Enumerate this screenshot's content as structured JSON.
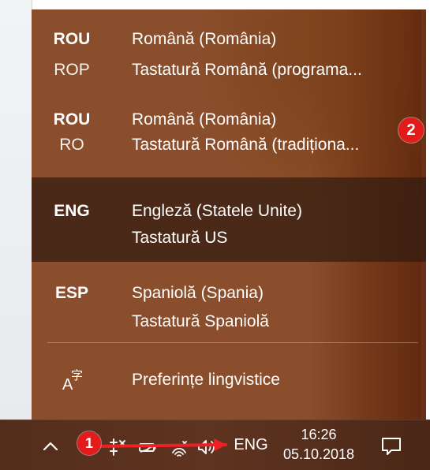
{
  "theme": {
    "flyout_background": "#8b4e2c",
    "selected_row_background": "#3b2218",
    "taskbar_background": "#5a311e",
    "text_color": "#ffffff",
    "badge_color": "#e41b1b"
  },
  "language_flyout": {
    "items": [
      {
        "code_primary": "ROU",
        "code_secondary": "ROP",
        "language": "Română (România)",
        "keyboard": "Tastatură Română (programa..."
      },
      {
        "code_primary": "ROU",
        "code_secondary": "RO",
        "language": "Română (România)",
        "keyboard": "Tastatură Română (tradiționa..."
      },
      {
        "code_primary": "ENG",
        "code_secondary": "",
        "language": "Engleză (Statele Unite)",
        "keyboard": "Tastatură US",
        "selected": true
      },
      {
        "code_primary": "ESP",
        "code_secondary": "",
        "language": "Spaniolă (Spania)",
        "keyboard": "Tastatură Spaniolă"
      }
    ],
    "preferences": {
      "label": "Preferințe lingvistice",
      "icon": "language-preferences-icon"
    }
  },
  "taskbar": {
    "show_hidden_icon": "chevron-up-icon",
    "tray_icons": [
      "network-icon",
      "battery-icon",
      "wifi-icon",
      "volume-icon"
    ],
    "input_language": "ENG",
    "time": "16:26",
    "date": "05.10.2018",
    "notification_icon": "action-center-icon"
  },
  "annotations": {
    "badge_1": "1",
    "badge_2": "2"
  }
}
